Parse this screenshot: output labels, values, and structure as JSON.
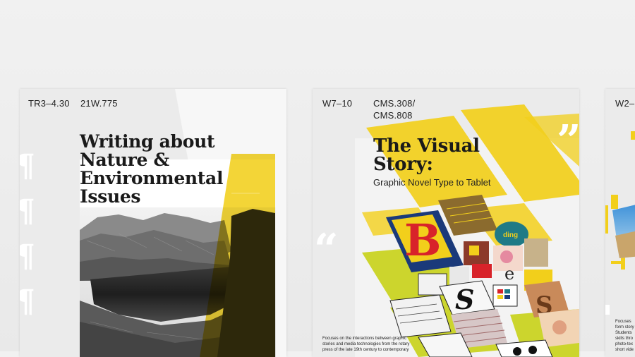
{
  "cards": [
    {
      "schedule": "TR3–4.30",
      "course_code": "21W.775",
      "title_lines": [
        "Writing about",
        "Nature &",
        "Environmental",
        "Issues"
      ],
      "decor_glyph": "¶"
    },
    {
      "schedule": "W7–10",
      "course_code_lines": [
        "CMS.308/",
        "CMS.808"
      ],
      "title_lines": [
        "The Visual",
        "Story:"
      ],
      "subtitle": "Graphic Novel Type to Tablet",
      "description_lines": [
        "Focuses on the interactions between graphic",
        "stories and media technologies from the rotary",
        "press of the late 19th century to contemporary"
      ],
      "letters": [
        "B",
        "S",
        "e",
        "S"
      ],
      "badge_text": "ding",
      "quote_glyph": "“",
      "quote_glyph_right": "”"
    },
    {
      "schedule": "W2–",
      "description_lines": [
        "Focuses",
        "form story",
        "Students",
        "skills thro",
        "photo-tex",
        "short vide"
      ]
    }
  ],
  "colors": {
    "accent_yellow": "#f2cf1b",
    "accent_lime": "#c9d21c",
    "red": "#d8232a"
  }
}
